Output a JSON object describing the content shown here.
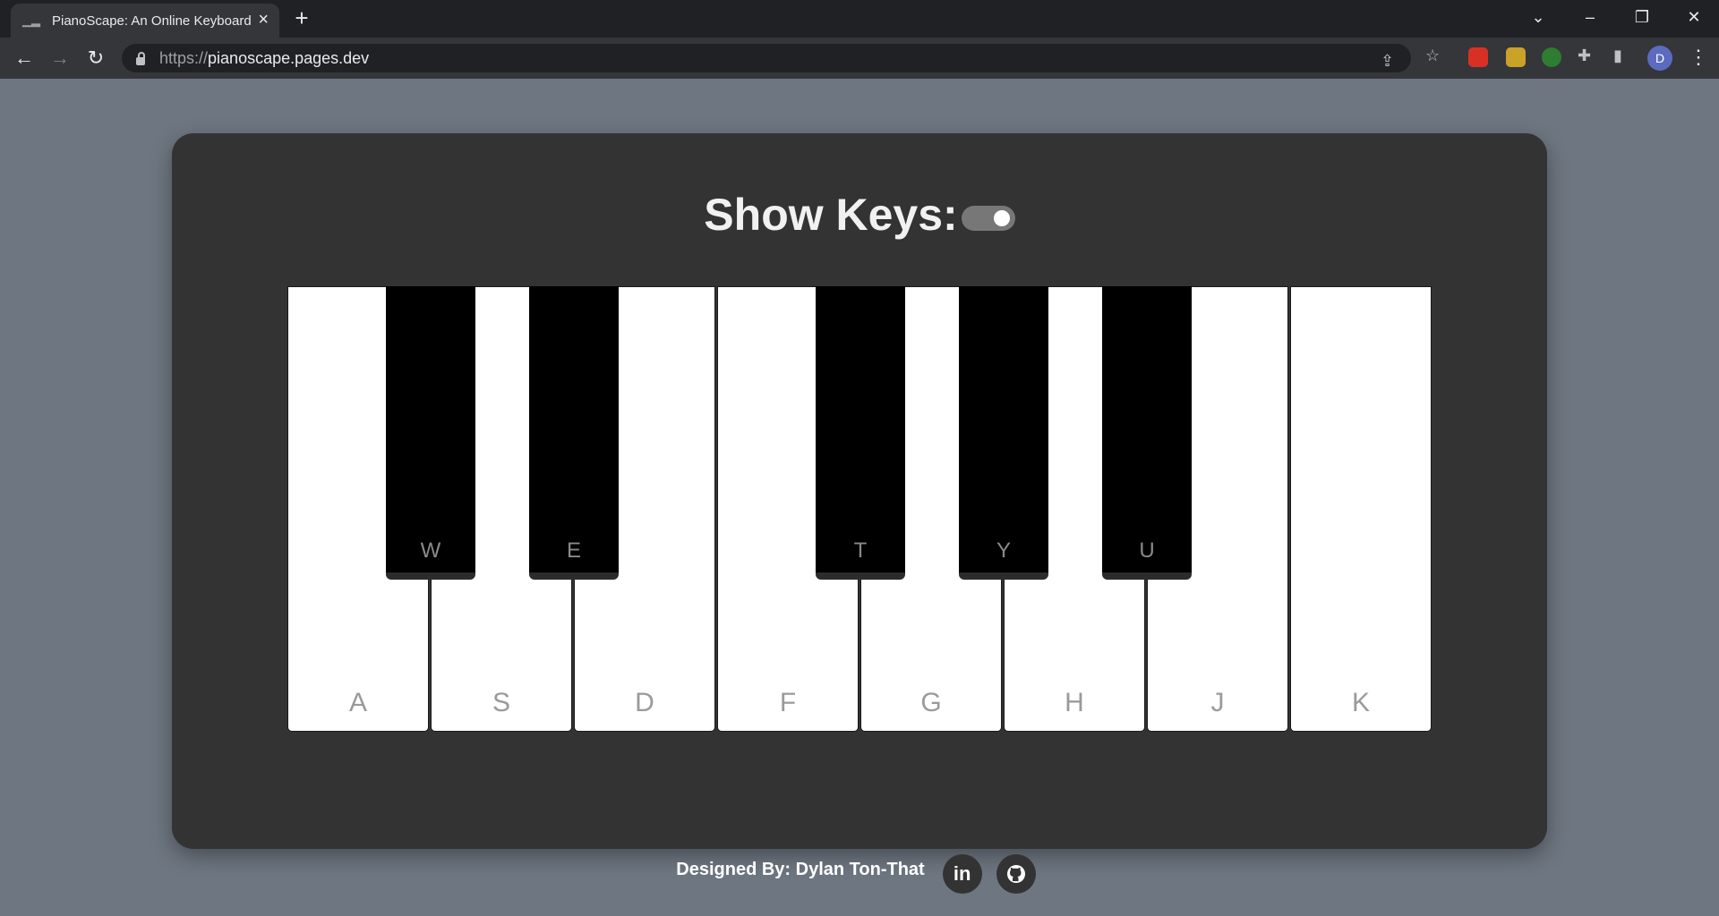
{
  "browser": {
    "tab_title": "PianoScape: An Online Keyboard",
    "url_scheme": "https://",
    "url_host": "pianoscape.pages.dev",
    "profile_initial": "D"
  },
  "page": {
    "show_keys_label": "Show Keys:",
    "show_keys_toggle_on": true,
    "white_keys": [
      "A",
      "S",
      "D",
      "F",
      "G",
      "H",
      "J",
      "K"
    ],
    "black_keys": [
      "W",
      "E",
      "T",
      "Y",
      "U"
    ],
    "footer_credit": "Designed By: Dylan Ton-That",
    "social_links": [
      "linkedin",
      "github"
    ]
  },
  "colors": {
    "page_background": "#6e7681",
    "card_background": "#333333",
    "toggle_track": "#777777"
  }
}
